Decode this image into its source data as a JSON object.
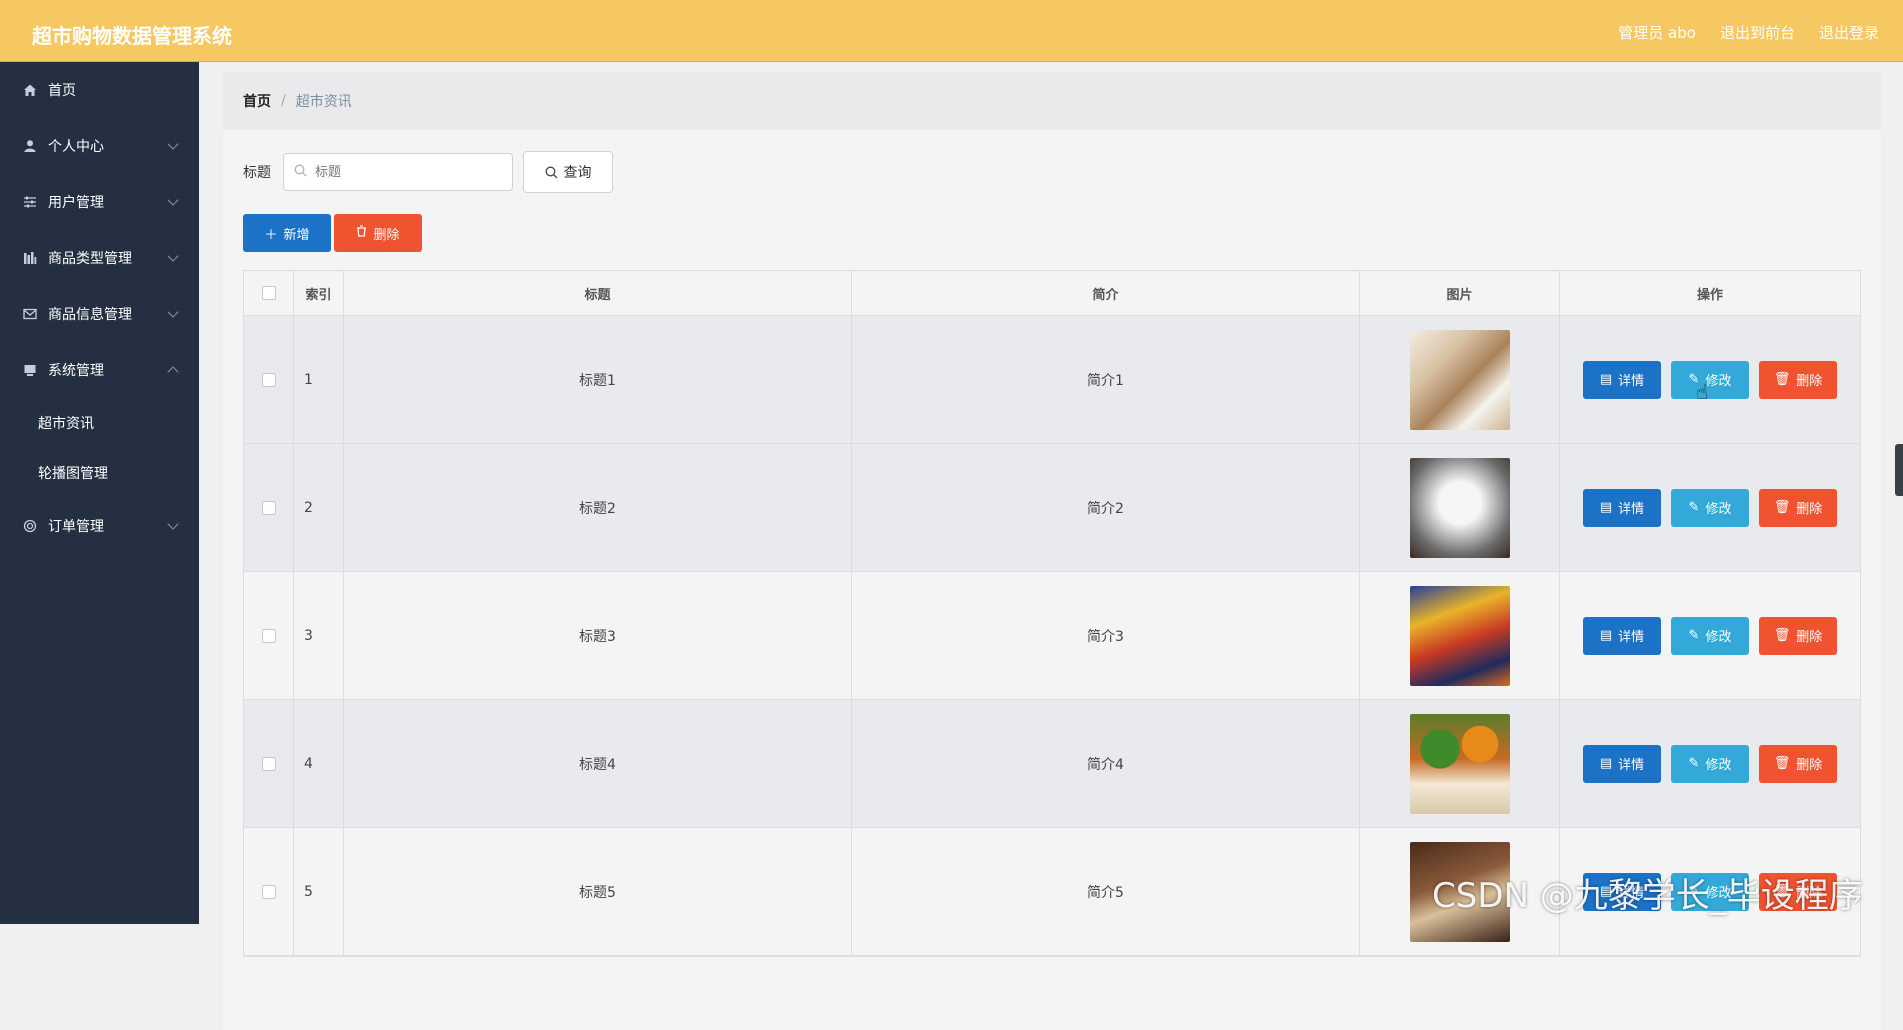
{
  "header": {
    "app_title": "超市购物数据管理系统",
    "user_label": "管理员 abo",
    "front_label": "退出到前台",
    "logout_label": "退出登录",
    "bg_color": "#f5c862"
  },
  "sidebar": {
    "items": [
      {
        "label": "首页",
        "icon": "home-icon"
      },
      {
        "label": "个人中心",
        "icon": "user-icon"
      },
      {
        "label": "用户管理",
        "icon": "sliders-icon"
      },
      {
        "label": "商品类型管理",
        "icon": "chart-icon"
      },
      {
        "label": "商品信息管理",
        "icon": "mail-icon"
      },
      {
        "label": "系统管理",
        "icon": "system-icon"
      },
      {
        "label": "订单管理",
        "icon": "circle-icon"
      }
    ],
    "sub_items": [
      "超市资讯",
      "轮播图管理"
    ]
  },
  "breadcrumb": {
    "home": "首页",
    "sep": "/",
    "current": "超市资讯"
  },
  "search": {
    "label": "标题",
    "placeholder": "标题",
    "query_label": "查询"
  },
  "actions": {
    "add_label": "新增",
    "delete_label": "删除"
  },
  "table": {
    "headers": [
      "索引",
      "标题",
      "简介",
      "图片",
      "操作"
    ],
    "rows": [
      {
        "index": "1",
        "title": "标题1",
        "desc": "简介1"
      },
      {
        "index": "2",
        "title": "标题2",
        "desc": "简介2"
      },
      {
        "index": "3",
        "title": "标题3",
        "desc": "简介3"
      },
      {
        "index": "4",
        "title": "标题4",
        "desc": "简介4"
      },
      {
        "index": "5",
        "title": "标题5",
        "desc": "简介5"
      }
    ],
    "op_labels": {
      "detail": "详情",
      "edit": "修改",
      "delete": "删除"
    }
  },
  "watermark": "CSDN @九黎学长_毕设程序"
}
